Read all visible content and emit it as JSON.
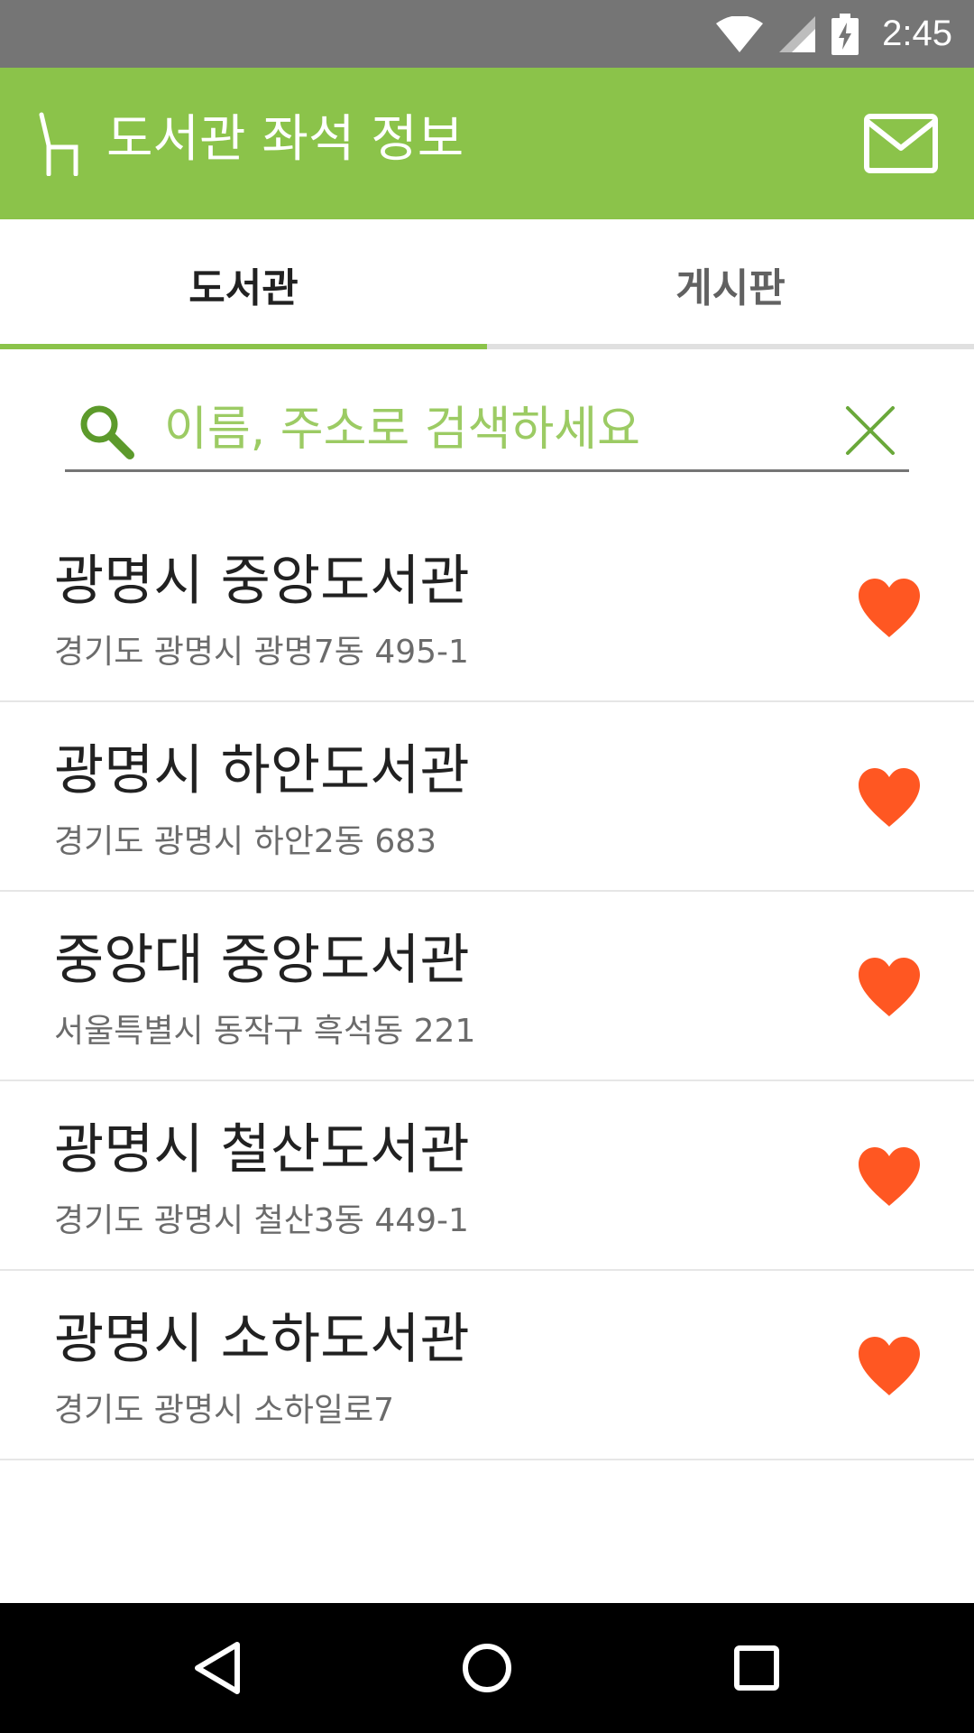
{
  "status_bar": {
    "time": "2:45",
    "icons": [
      "wifi-icon",
      "cell-signal-icon",
      "battery-charging-icon"
    ]
  },
  "app_bar": {
    "title": "도서관 좌석 정보",
    "logo_icon": "chair-icon",
    "action_icon": "mail-icon"
  },
  "tabs": [
    {
      "label": "도서관",
      "selected": true
    },
    {
      "label": "게시판",
      "selected": false
    }
  ],
  "search": {
    "placeholder": "이름, 주소로 검색하세요",
    "value": ""
  },
  "libraries": [
    {
      "name": "광명시 중앙도서관",
      "address": "경기도 광명시 광명7동 495-1",
      "favorite": true
    },
    {
      "name": "광명시 하안도서관",
      "address": "경기도 광명시 하안2동 683",
      "favorite": true
    },
    {
      "name": "중앙대 중앙도서관",
      "address": "서울특별시 동작구 흑석동 221",
      "favorite": true
    },
    {
      "name": "광명시 철산도서관",
      "address": "경기도 광명시 철산3동 449-1",
      "favorite": true
    },
    {
      "name": "광명시 소하도서관",
      "address": "경기도 광명시 소하일로7",
      "favorite": true
    }
  ],
  "colors": {
    "accent": "#8bc34a",
    "favorite": "#ff5722",
    "status_bar": "#757575"
  },
  "nav_bar": [
    "back-icon",
    "home-icon",
    "recents-icon"
  ]
}
